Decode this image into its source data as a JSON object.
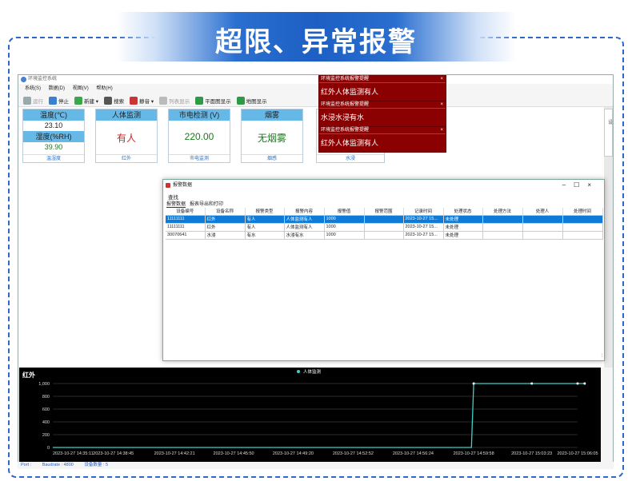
{
  "banner": {
    "title": "超限、异常报警"
  },
  "app": {
    "title": "环境监控系统",
    "menu": [
      "系统(S)",
      "数据(D)",
      "视图(V)",
      "帮助(H)"
    ],
    "toolbar": [
      {
        "label": "运行",
        "icon": "play-icon",
        "disabled": true,
        "color": "#9aa"
      },
      {
        "label": "停止",
        "icon": "stop-icon",
        "disabled": false,
        "color": "#3a7fd0"
      },
      {
        "label": "新建 ▾",
        "icon": "add-icon",
        "disabled": false,
        "color": "#3aa84a"
      },
      {
        "label": "搜索",
        "icon": "search-icon",
        "disabled": false,
        "color": "#555"
      },
      {
        "label": "静音 ▾",
        "icon": "mute-icon",
        "disabled": false,
        "color": "#c33"
      },
      {
        "label": "列表显示",
        "icon": "list-icon",
        "disabled": true,
        "color": "#bbb"
      },
      {
        "label": "平面图显示",
        "icon": "floorplan-icon",
        "disabled": false,
        "color": "#2f9a45"
      },
      {
        "label": "地图显示",
        "icon": "map-icon",
        "disabled": false,
        "color": "#2f9a45"
      }
    ]
  },
  "cards": {
    "temp": {
      "title": "温度(℃)",
      "value": "23.10",
      "hum_title": "湿度(%RH)",
      "hum_value": "39.90",
      "footer": "温湿度"
    },
    "infrared": {
      "title": "人体监测",
      "value": "有人",
      "footer": "红外",
      "color": "#d42020"
    },
    "power": {
      "title": "市电检测 (V)",
      "value": "220.00",
      "footer": "市电监测",
      "color": "#1a7a1a"
    },
    "smoke": {
      "title": "烟雾",
      "value": "无烟雾",
      "footer": "烟感",
      "color": "#1a7a1a"
    },
    "water": {
      "footer": "水浸"
    }
  },
  "alerts": [
    {
      "title": "环境监控系统报警提醒",
      "message": "红外人体监测有人"
    },
    {
      "title": "环境监控系统报警提醒",
      "message": "水浸水浸有水"
    },
    {
      "title": "环境监控系统报警提醒",
      "message": "红外人体监测有人"
    }
  ],
  "side_panel": {
    "label": "设"
  },
  "dialog": {
    "title": "报警数据",
    "find_label": "查找",
    "tabs": [
      "报警数据",
      "报表导出和打印"
    ],
    "columns": [
      "设备编号",
      "设备名称",
      "报警类型",
      "报警内容",
      "报警值",
      "报警范围",
      "记录时间",
      "处理状态",
      "处理方法",
      "处理人",
      "处理时间"
    ],
    "rows": [
      [
        "11111111",
        "红外",
        "有人",
        "人体监测有人",
        "1000",
        "",
        "2023-10-27 15...",
        "未处理",
        "",
        "",
        ""
      ],
      [
        "11111111",
        "红外",
        "有人",
        "人体监测有人",
        "1000",
        "",
        "2023-10-27 15...",
        "未处理",
        "",
        "",
        ""
      ],
      [
        "30070641",
        "水浸",
        "有水",
        "水浸有水",
        "1000",
        "",
        "2023-10-27 15...",
        "未处理",
        "",
        "",
        ""
      ]
    ]
  },
  "chart_data": {
    "type": "line",
    "title": "红外",
    "series": [
      {
        "name": "人体监测",
        "color": "#3fd0c8",
        "x": [
          "2023-10-27 14:35:11",
          "2023-10-27 14:59:50",
          "2023-10-27 14:59:58",
          "2023-10-27 15:03:23",
          "2023-10-27 15:06:05",
          "2023-10-27 15:06:30"
        ],
        "values": [
          0,
          0,
          1000,
          1000,
          1000,
          1000
        ]
      }
    ],
    "x_ticks": [
      "2023-10-27 14:35:11",
      "2023-10-27 14:38:45",
      "2023-10-27 14:42:21",
      "2023-10-27 14:45:50",
      "2023-10-27 14:49:20",
      "2023-10-27 14:52:52",
      "2023-10-27 14:56:24",
      "2023-10-27 14:59:58",
      "2023-10-27 15:03:23",
      "2023-10-27 15:06:05"
    ],
    "y_ticks": [
      "1,000",
      "800",
      "600",
      "400",
      "200",
      "0"
    ],
    "ylim": [
      0,
      1000
    ],
    "grid": true,
    "legend": "top-center"
  },
  "status": {
    "port": "Port :",
    "baud": "Baudrate : 4800",
    "count": "设备数量 : 5"
  }
}
